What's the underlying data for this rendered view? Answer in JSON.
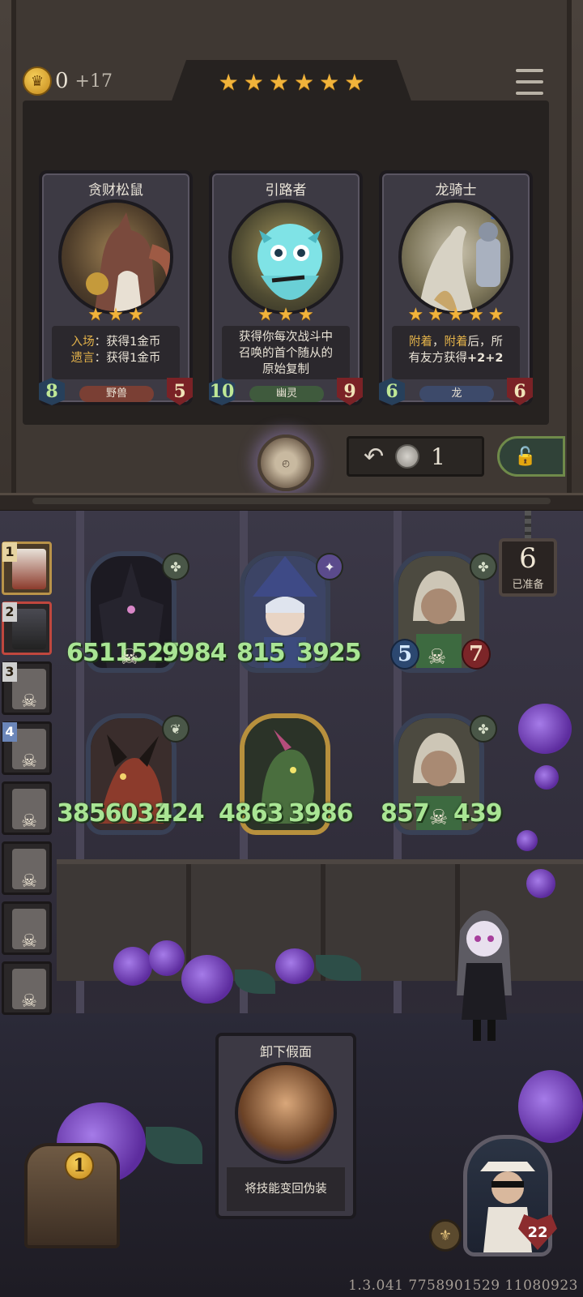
{
  "shop": {
    "gold": "0",
    "gold_income": "+17",
    "tavern_tier_stars": [
      "★",
      "★",
      "★",
      "★",
      "★",
      "★"
    ],
    "refresh_cost": "1",
    "icons": {
      "gold": "crown-coin-icon",
      "menu": "hamburger-menu-icon",
      "refresh": "undo-arrow-icon",
      "lock": "padlock-icon",
      "watch": "pocket-watch-icon"
    },
    "cards": [
      {
        "name": "贪财松鼠",
        "stars": [
          "★",
          "★",
          "★"
        ],
        "desc_line1_kw": "入场",
        "desc_line1": "：获得1金币",
        "desc_line2_kw": "遗言",
        "desc_line2": "：获得1金币",
        "attack": "8",
        "health": "5",
        "tribe": "野兽",
        "tribe_color": "#7a3f34"
      },
      {
        "name": "引路者",
        "stars": [
          "★",
          "★",
          "★"
        ],
        "desc_line1": "获得你每次战斗中",
        "desc_line2": "召唤的首个随从的",
        "desc_line3": "原始复制",
        "attack": "10",
        "health": "9",
        "tribe": "幽灵",
        "tribe_color": "#3f5a3d"
      },
      {
        "name": "龙骑士",
        "stars": [
          "★",
          "★",
          "★",
          "★",
          "★"
        ],
        "desc_line1_kw": "附着",
        "desc_line1_sep": "，",
        "desc_line1_kw2": "附着",
        "desc_line1": "后，所",
        "desc_line2": "有友方获得",
        "desc_line2_bold": "+2+2",
        "attack": "6",
        "health": "6",
        "tribe": "龙",
        "tribe_color": "#3d4a6a"
      }
    ]
  },
  "battle": {
    "players": [
      {
        "rank": "1",
        "dead": false
      },
      {
        "rank": "2",
        "dead": false
      },
      {
        "rank": "3",
        "dead": true
      },
      {
        "rank": "4",
        "dead": true
      },
      {
        "rank": "",
        "dead": true
      },
      {
        "rank": "",
        "dead": true
      },
      {
        "rank": "",
        "dead": true
      },
      {
        "rank": "",
        "dead": true
      }
    ],
    "skull_glyph": "☠",
    "ready_count": "6",
    "ready_label": "已准备",
    "minions": [
      {
        "atk": "6511527",
        "hp": "9984",
        "tag_icon": "beast-paw-icon"
      },
      {
        "atk": "815",
        "hp": "3925",
        "tag_icon": "star-burst-icon"
      },
      {
        "atk": "5",
        "hp": "7",
        "tag_icon": "beast-paw-icon"
      },
      {
        "atk": "3856031",
        "hp": "424",
        "tag_icon": "dragon-icon"
      },
      {
        "atk": "4863",
        "hp": "3986",
        "tag_icon": ""
      },
      {
        "atk": "857",
        "hp": "439",
        "tag_icon": "beast-paw-icon"
      }
    ],
    "hero_power": {
      "name": "卸下假面",
      "desc": "将技能变回伪装"
    },
    "chest_count": "1",
    "hero_health": "22",
    "version": "1.3.041 7758901529 11080923"
  },
  "colors": {
    "star": "#f1b33a",
    "keyword": "#e3b24a",
    "damage_number": "#a9e594"
  }
}
